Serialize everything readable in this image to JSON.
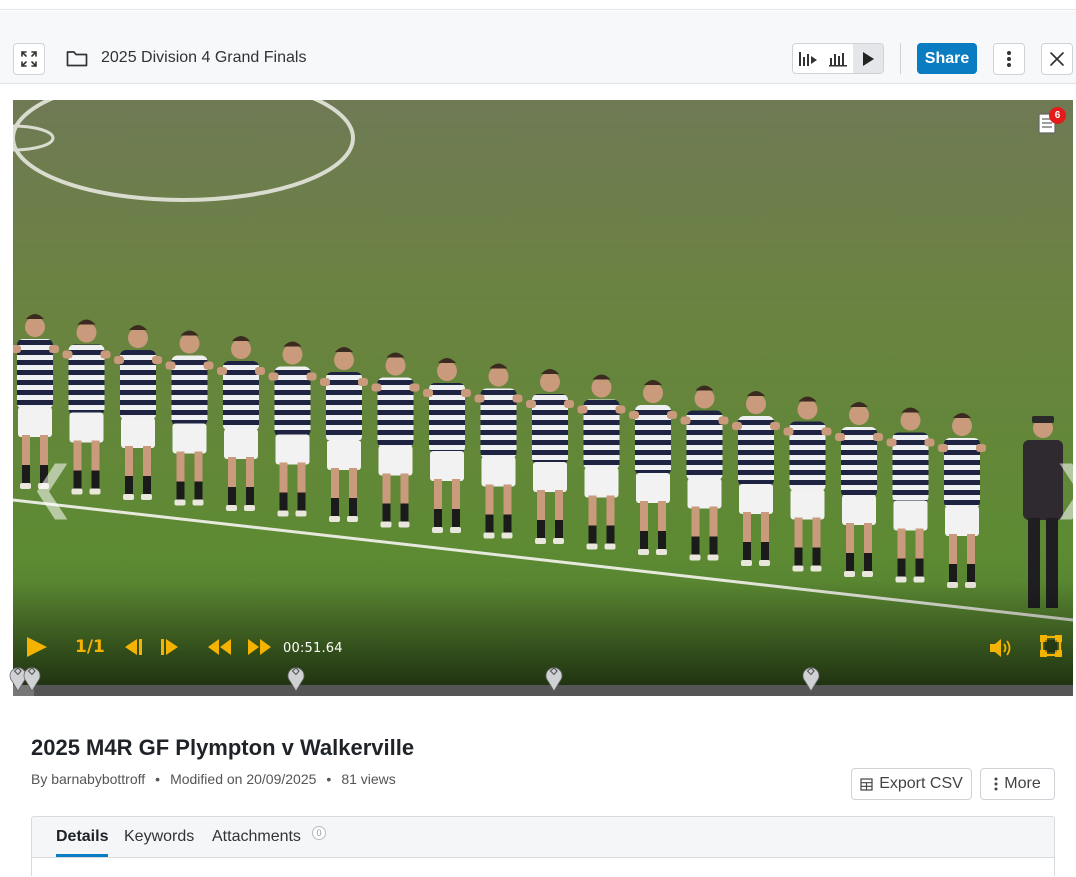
{
  "header": {
    "title": "2025 Division 4 Grand Finals",
    "share_label": "Share"
  },
  "player": {
    "timecode": "00:51.64",
    "speed_label": "1/1",
    "notes_count": "6",
    "nav_prev": "❮",
    "nav_next": "❯",
    "progress": 0.02,
    "accent_color": "#f5b301"
  },
  "clip": {
    "title": "2025 M4R GF Plympton v Walkerville",
    "author": "By barnabybottroff",
    "modified": "Modified on 20/09/2025",
    "views": "81 views",
    "separator": "•"
  },
  "actions": {
    "export_label": "Export CSV",
    "more_label": "More"
  },
  "tabs": [
    {
      "label": "Details",
      "active": true
    },
    {
      "label": "Keywords",
      "active": false
    },
    {
      "label": "Attachments",
      "active": false,
      "count": "0"
    }
  ],
  "colors": {
    "brand": "#0a7cc2",
    "badge": "#e21b1b"
  }
}
